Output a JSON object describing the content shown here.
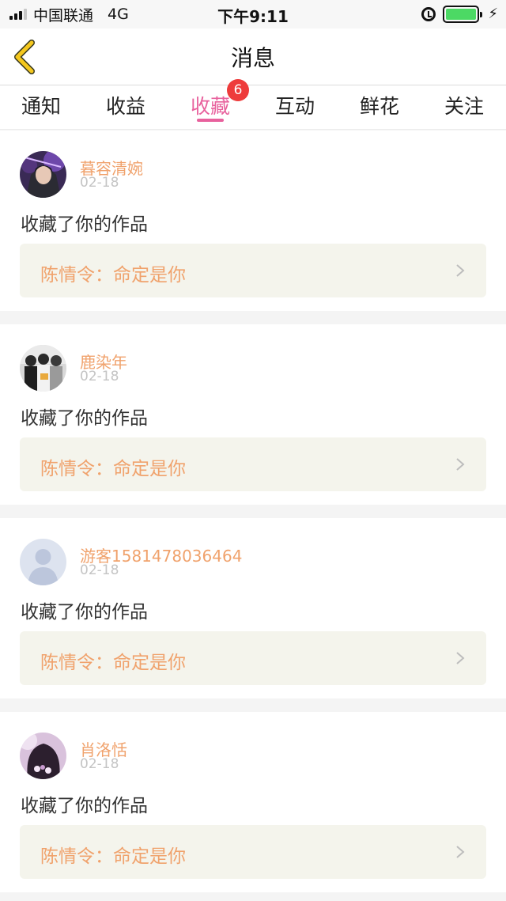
{
  "status_bar": {
    "carrier": "中国联通",
    "network": "4G",
    "time": "下午9:11",
    "battery_color": "#4cd964"
  },
  "header": {
    "title": "消息",
    "back_icon": "chevron-left-icon",
    "back_color": "#f5c81e"
  },
  "tabs": {
    "items": [
      {
        "label": "通知"
      },
      {
        "label": "收益"
      },
      {
        "label": "收藏",
        "active": true,
        "badge": "6"
      },
      {
        "label": "互动"
      },
      {
        "label": "鲜花"
      },
      {
        "label": "关注"
      }
    ],
    "active_color": "#e8619d",
    "badge_color": "#ee3b3b"
  },
  "messages": [
    {
      "user": "暮容清婉",
      "date": "02-18",
      "action": "收藏了你的作品",
      "work": "陈情令：命定是你",
      "avatar": "anime-character-avatar"
    },
    {
      "user": "鹿染年",
      "date": "02-18",
      "action": "收藏了你的作品",
      "work": "陈情令：命定是你",
      "avatar": "group-photo-avatar"
    },
    {
      "user": "游客1581478036464",
      "date": "02-18",
      "action": "收藏了你的作品",
      "work": "陈情令：命定是你",
      "avatar": "default-user-avatar"
    },
    {
      "user": "肖洛恬",
      "date": "02-18",
      "action": "收藏了你的作品",
      "work": "陈情令：命定是你",
      "avatar": "girl-hair-avatar"
    }
  ],
  "colors": {
    "username": "#f0a26c",
    "work_title": "#f0a26c",
    "work_bg": "#f4f4ec"
  }
}
